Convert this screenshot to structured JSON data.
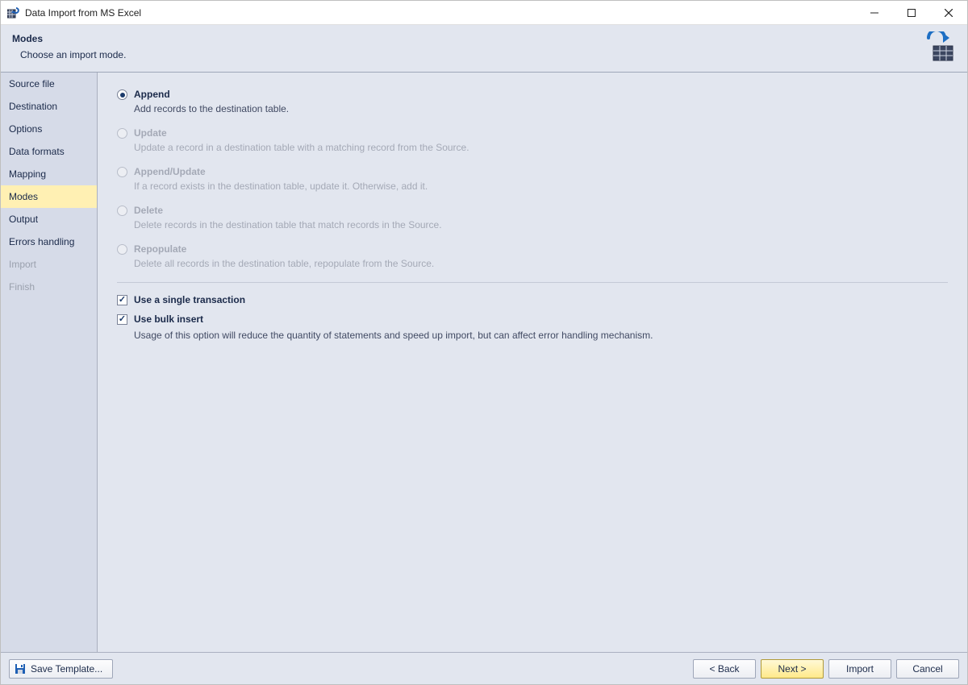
{
  "window": {
    "title": "Data Import from MS Excel"
  },
  "header": {
    "title": "Modes",
    "subtitle": "Choose an import mode."
  },
  "sidebar": {
    "items": [
      {
        "label": "Source file",
        "state": "normal"
      },
      {
        "label": "Destination",
        "state": "normal"
      },
      {
        "label": "Options",
        "state": "normal"
      },
      {
        "label": "Data formats",
        "state": "normal"
      },
      {
        "label": "Mapping",
        "state": "normal"
      },
      {
        "label": "Modes",
        "state": "active"
      },
      {
        "label": "Output",
        "state": "normal"
      },
      {
        "label": "Errors handling",
        "state": "normal"
      },
      {
        "label": "Import",
        "state": "disabled"
      },
      {
        "label": "Finish",
        "state": "disabled"
      }
    ]
  },
  "modes": [
    {
      "label": "Append",
      "desc": "Add records to the destination table.",
      "selected": true,
      "enabled": true
    },
    {
      "label": "Update",
      "desc": "Update a record in a destination table with a matching record from the Source.",
      "selected": false,
      "enabled": false
    },
    {
      "label": "Append/Update",
      "desc": "If a record exists in the destination table, update it. Otherwise, add it.",
      "selected": false,
      "enabled": false
    },
    {
      "label": "Delete",
      "desc": "Delete records in the destination table that match records in the Source.",
      "selected": false,
      "enabled": false
    },
    {
      "label": "Repopulate",
      "desc": "Delete all records in the destination table, repopulate from the Source.",
      "selected": false,
      "enabled": false
    }
  ],
  "checks": {
    "single_transaction": {
      "label": "Use a single transaction",
      "checked": true
    },
    "bulk_insert": {
      "label": "Use bulk insert",
      "checked": true,
      "desc": "Usage of this option will reduce the quantity of statements and speed up import, but can affect error handling mechanism."
    }
  },
  "footer": {
    "save_template": "Save Template...",
    "back": "< Back",
    "next": "Next >",
    "import": "Import",
    "cancel": "Cancel"
  }
}
